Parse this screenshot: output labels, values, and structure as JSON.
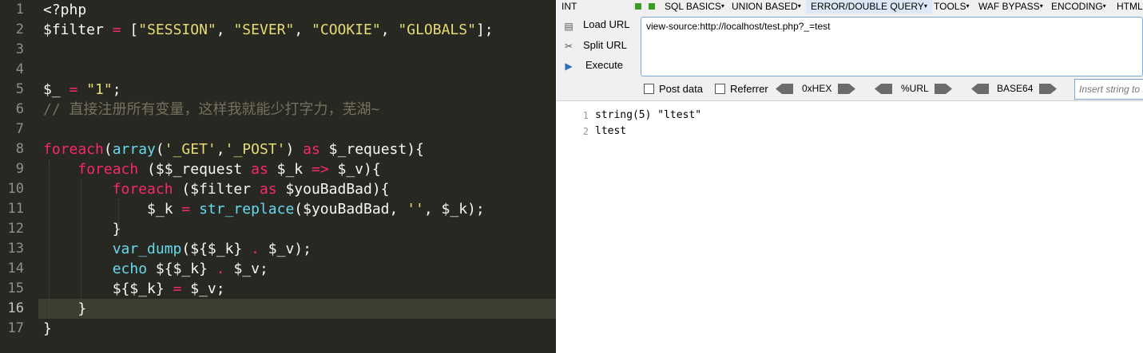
{
  "editor": {
    "active_line": 16,
    "colors": {
      "background": "#272822",
      "keyword": "#f92672",
      "string": "#e6db74",
      "function": "#66d9ef",
      "comment": "#75715e"
    },
    "lines": [
      [
        [
          "t",
          "<?php"
        ]
      ],
      [
        [
          "t",
          "$filter "
        ],
        [
          "op",
          "="
        ],
        [
          "t",
          " ["
        ],
        [
          "s",
          "\"SESSION\""
        ],
        [
          "t",
          ", "
        ],
        [
          "s",
          "\"SEVER\""
        ],
        [
          "t",
          ", "
        ],
        [
          "s",
          "\"COOKIE\""
        ],
        [
          "t",
          ", "
        ],
        [
          "s",
          "\"GLOBALS\""
        ],
        [
          "t",
          "];"
        ]
      ],
      [],
      [],
      [
        [
          "t",
          "$_ "
        ],
        [
          "op",
          "="
        ],
        [
          "t",
          " "
        ],
        [
          "s",
          "\"1\""
        ],
        [
          "t",
          ";"
        ]
      ],
      [
        [
          "c",
          "// 直接注册所有变量，这样我就能少打字力，芜湖~"
        ]
      ],
      [],
      [
        [
          "k",
          "foreach"
        ],
        [
          "t",
          "("
        ],
        [
          "f",
          "array"
        ],
        [
          "t",
          "("
        ],
        [
          "s",
          "'_GET'"
        ],
        [
          "t",
          ","
        ],
        [
          "s",
          "'_POST'"
        ],
        [
          "t",
          ") "
        ],
        [
          "k",
          "as"
        ],
        [
          "t",
          " $_request){"
        ]
      ],
      [
        [
          "t",
          "    "
        ],
        [
          "k",
          "foreach"
        ],
        [
          "t",
          " ($$_request "
        ],
        [
          "k",
          "as"
        ],
        [
          "t",
          " $_k "
        ],
        [
          "op",
          "=>"
        ],
        [
          "t",
          " $_v){"
        ]
      ],
      [
        [
          "t",
          "        "
        ],
        [
          "k",
          "foreach"
        ],
        [
          "t",
          " ($filter "
        ],
        [
          "k",
          "as"
        ],
        [
          "t",
          " $youBadBad){"
        ]
      ],
      [
        [
          "t",
          "            $_k "
        ],
        [
          "op",
          "="
        ],
        [
          "t",
          " "
        ],
        [
          "f",
          "str_replace"
        ],
        [
          "t",
          "($youBadBad, "
        ],
        [
          "s",
          "''"
        ],
        [
          "t",
          ", $_k);"
        ]
      ],
      [
        [
          "t",
          "        }"
        ]
      ],
      [
        [
          "t",
          "        "
        ],
        [
          "f",
          "var_dump"
        ],
        [
          "t",
          "(${$_k} "
        ],
        [
          "op",
          "."
        ],
        [
          "t",
          " $_v);"
        ]
      ],
      [
        [
          "t",
          "        "
        ],
        [
          "f",
          "echo"
        ],
        [
          "t",
          " ${$_k} "
        ],
        [
          "op",
          "."
        ],
        [
          "t",
          " $_v;"
        ]
      ],
      [
        [
          "t",
          "        ${$_k} "
        ],
        [
          "op",
          "="
        ],
        [
          "t",
          " $_v;"
        ]
      ],
      [
        [
          "t",
          "    }"
        ]
      ],
      [
        [
          "t",
          "}"
        ]
      ]
    ]
  },
  "hackbar": {
    "menu": {
      "int": "INT",
      "sql_basics": "SQL BASICS",
      "union_based": "UNION BASED",
      "error_double_query": "ERROR/DOUBLE QUERY",
      "tools": "TOOLS",
      "waf_bypass": "WAF BYPASS",
      "encoding": "ENCODING",
      "html": "HTML"
    },
    "load_url_label": "Load URL",
    "split_url_label": "Split URL",
    "execute_label": "Execute",
    "url_value": "view-source:http://localhost/test.php?_=test",
    "post_data_label": "Post data",
    "referrer_label": "Referrer",
    "hex_label": "0xHEX",
    "url_enc_label": "%URL",
    "base64_label": "BASE64",
    "insert_placeholder": "Insert string to replace"
  },
  "output": {
    "lines": [
      {
        "num": "1",
        "text": "string(5) \"ltest\""
      },
      {
        "num": "2",
        "text": "ltest"
      }
    ]
  }
}
